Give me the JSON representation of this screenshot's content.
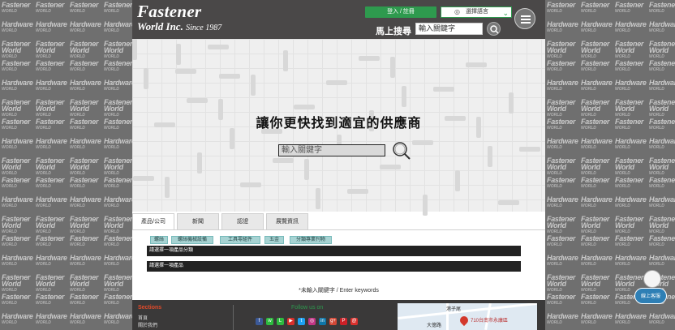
{
  "side_tiles": {
    "line1": "Fastener",
    "line2": "WORLD",
    "line3": "Hardware",
    "line4": "Fastener World"
  },
  "header": {
    "logo_line1": "Fastener",
    "logo_line2": "World Inc.",
    "logo_since": "Since 1987",
    "login_label": "登入 / 註冊",
    "language_label": "選擇語言",
    "quick_search_label": "馬上搜尋",
    "quick_search_placeholder": "輸入關鍵字"
  },
  "hero": {
    "title": "讓你更快找到適宜的供應商",
    "search_placeholder": "輸入關鍵字"
  },
  "tabs": [
    {
      "label": "產品/公司",
      "active": true
    },
    {
      "label": "新聞",
      "active": false
    },
    {
      "label": "認證",
      "active": false
    },
    {
      "label": "展覽資訊",
      "active": false
    }
  ],
  "chips": [
    "螺絲",
    "螺絲機械設備",
    "工具零組件",
    "五金",
    "分類專業刊物"
  ],
  "selects": {
    "category": "請選擇一項產品分類",
    "product": "請選擇一項產品"
  },
  "keyword_note": "*未輸入關鍵字 / Enter keywords",
  "footer": {
    "sections_title": "Sections",
    "items": [
      "首頁",
      "關於我們"
    ],
    "follow_title": "Follow us on",
    "social_icons": [
      {
        "icon": "facebook-icon",
        "glyph": "f",
        "color": "#3b5998"
      },
      {
        "icon": "wechat-icon",
        "glyph": "w",
        "color": "#2dbb3f"
      },
      {
        "icon": "line-icon",
        "glyph": "L",
        "color": "#2dbb3f"
      },
      {
        "icon": "youtube-icon",
        "glyph": "▶",
        "color": "#d9302c"
      },
      {
        "icon": "twitter-icon",
        "glyph": "t",
        "color": "#1da1f2"
      },
      {
        "icon": "instagram-icon",
        "glyph": "◎",
        "color": "#c13584"
      },
      {
        "icon": "linkedin-icon",
        "glyph": "in",
        "color": "#0e76a8"
      },
      {
        "icon": "googleplus-icon",
        "glyph": "g+",
        "color": "#d34836"
      },
      {
        "icon": "pinterest-icon",
        "glyph": "P",
        "color": "#cb2027"
      },
      {
        "icon": "email-icon",
        "glyph": "@",
        "color": "#d9302c"
      }
    ],
    "map_labels": [
      "港子尾",
      "710台南市永康區",
      "大億路"
    ]
  },
  "chat_widget": {
    "label": "線上客服"
  }
}
